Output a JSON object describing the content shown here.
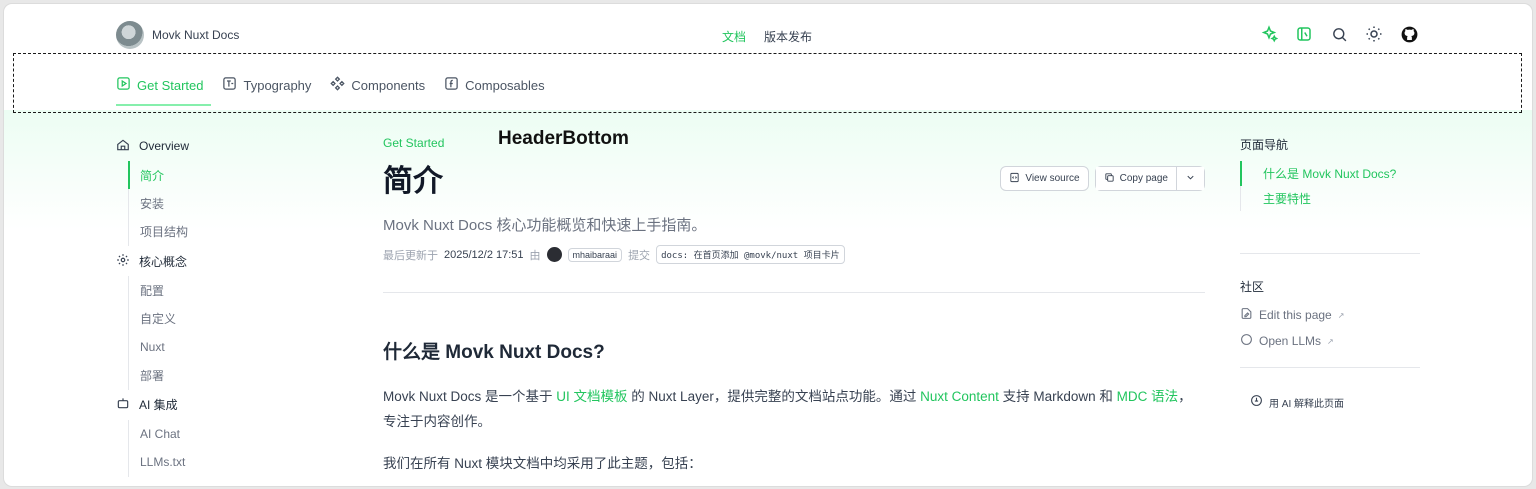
{
  "header": {
    "brand_name": "Movk Nuxt Docs",
    "nav": [
      {
        "label": "文档",
        "active": true
      },
      {
        "label": "版本发布",
        "active": false
      }
    ],
    "icons": [
      "sparkle-icon",
      "book-icon",
      "search-icon",
      "sun-icon",
      "github-icon"
    ]
  },
  "tabs": [
    {
      "label": "Get Started",
      "icon": "play-square-icon",
      "active": true
    },
    {
      "label": "Typography",
      "icon": "typography-icon",
      "active": false
    },
    {
      "label": "Components",
      "icon": "components-icon",
      "active": false
    },
    {
      "label": "Composables",
      "icon": "function-icon",
      "active": false
    }
  ],
  "annotation": "HeaderBottom",
  "sidebar": {
    "sections": [
      {
        "title": "Overview",
        "icon": "home-icon",
        "items": [
          {
            "label": "简介",
            "active": true
          },
          {
            "label": "安装",
            "active": false
          },
          {
            "label": "项目结构",
            "active": false
          }
        ]
      },
      {
        "title": "核心概念",
        "icon": "cog-icon",
        "items": [
          {
            "label": "配置",
            "active": false
          },
          {
            "label": "自定义",
            "active": false
          },
          {
            "label": "Nuxt",
            "active": false
          },
          {
            "label": "部署",
            "active": false
          }
        ]
      },
      {
        "title": "AI 集成",
        "icon": "robot-icon",
        "items": [
          {
            "label": "AI Chat",
            "active": false
          },
          {
            "label": "LLMs.txt",
            "active": false
          }
        ]
      }
    ]
  },
  "main": {
    "eyebrow": "Get Started",
    "title": "简介",
    "view_source": "View source",
    "copy_page": "Copy page",
    "lead": "Movk Nuxt Docs 核心功能概览和快速上手指南。",
    "meta": {
      "updated_label": "最后更新于",
      "date": "2025/12/2 17:51",
      "by": "由",
      "author": "mhaibaraai",
      "commit_label": "提交",
      "commit": "docs: 在首页添加 @movk/nuxt 项目卡片"
    },
    "h2": "什么是 Movk Nuxt Docs?",
    "para": {
      "t1": "Movk Nuxt Docs 是一个基于 ",
      "l1": "UI 文档模板",
      "t2": " 的 Nuxt Layer，提供完整的文档站点功能。通过 ",
      "l2": "Nuxt Content",
      "t3": " 支持 Markdown 和 ",
      "l3": "MDC 语法",
      "t4": "，专注于内容创作。"
    },
    "para2": "我们在所有 Nuxt 模块文档中均采用了此主题，包括："
  },
  "toc": {
    "title": "页面导航",
    "items": [
      {
        "label": "什么是 Movk Nuxt Docs?",
        "active": true
      },
      {
        "label": "主要特性",
        "active": false
      }
    ],
    "community_title": "社区",
    "community": [
      {
        "label": "Edit this page",
        "icon": "edit-file-icon"
      },
      {
        "label": "Open LLMs",
        "icon": "chat-icon"
      }
    ],
    "ai_explain": "用 AI 解释此页面"
  },
  "colors": {
    "accent": "#22c55e"
  }
}
